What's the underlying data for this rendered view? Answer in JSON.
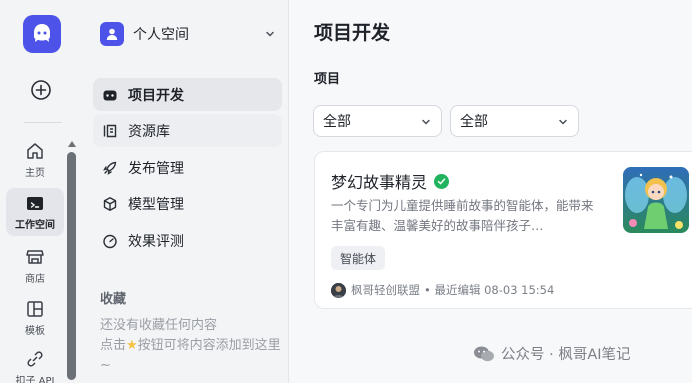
{
  "rail": {
    "items": [
      {
        "label": "主页",
        "icon": "home-icon"
      },
      {
        "label": "工作空间",
        "icon": "workspace-icon",
        "active": true
      },
      {
        "label": "商店",
        "icon": "store-icon"
      },
      {
        "label": "模板",
        "icon": "template-icon"
      },
      {
        "label": "扣子 API",
        "icon": "api-icon"
      }
    ]
  },
  "sidebar": {
    "space_name": "个人空间",
    "nav": [
      {
        "label": "项目开发",
        "icon": "bot-icon",
        "active": true
      },
      {
        "label": "资源库",
        "icon": "library-icon"
      },
      {
        "label": "发布管理",
        "icon": "rocket-icon"
      },
      {
        "label": "模型管理",
        "icon": "cube-icon"
      },
      {
        "label": "效果评测",
        "icon": "gauge-icon"
      }
    ],
    "favorites": {
      "title": "收藏",
      "empty_line1": "还没有收藏任何内容",
      "empty_prefix": "点击",
      "empty_suffix": "按钮可将内容添加到这里~"
    }
  },
  "main": {
    "title": "项目开发",
    "section": "项目",
    "filters": [
      {
        "value": "全部"
      },
      {
        "value": "全部"
      }
    ],
    "card": {
      "title": "梦幻故事精灵",
      "description": "一个专门为儿童提供睡前故事的智能体，能带来丰富有趣、温馨美好的故事陪伴孩子…",
      "tag": "智能体",
      "author": "枫哥轻创联盟",
      "edited": "• 最近编辑 08-03 15:54"
    },
    "watermark": "公众号 · 枫哥AI笔记"
  },
  "colors": {
    "brand": "#4d53e8",
    "verified": "#22b35e"
  }
}
